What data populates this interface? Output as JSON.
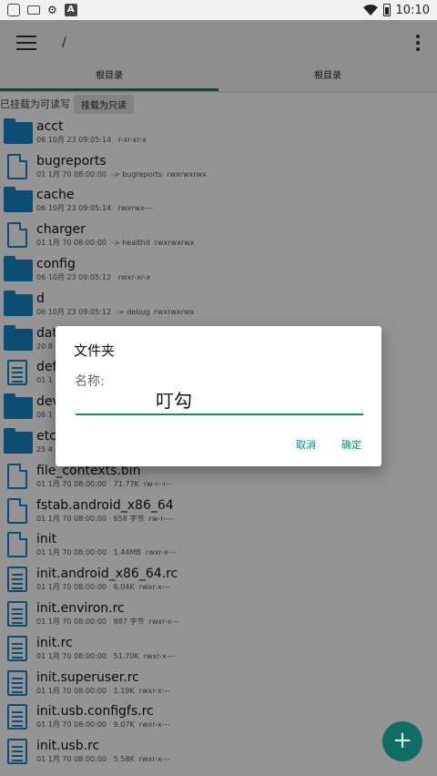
{
  "status_bar": {
    "time": "10:10",
    "icons": [
      "square-icon",
      "keyboard-icon",
      "app-icon",
      "a-icon",
      "wifi-icon",
      "battery-icon"
    ]
  },
  "app_bar": {
    "path": "/"
  },
  "tabs": [
    {
      "label": "根目录",
      "active": true
    },
    {
      "label": "根目录",
      "active": false
    }
  ],
  "mount": {
    "status": "已挂载为可读写",
    "button": "挂载为只读"
  },
  "files": [
    {
      "name": "acct",
      "meta": "06 10月 23 09:05:14   r-xr-xr-x",
      "kind": "folder"
    },
    {
      "name": "bugreports",
      "meta": "01 1月 70 08:00:00  -> bugreports  rwxrwxrwx",
      "kind": "file"
    },
    {
      "name": "cache",
      "meta": "06 10月 23 09:05:14   rwxrwx---",
      "kind": "folder"
    },
    {
      "name": "charger",
      "meta": "01 1月 70 08:00:00  -> healthd  rwxrwxrwx",
      "kind": "file"
    },
    {
      "name": "config",
      "meta": "06 10月 23 09:05:12   rwxr-xr-x",
      "kind": "folder"
    },
    {
      "name": "d",
      "meta": "06 10月 23 09:05:12  -> debug  rwxrwxrwx",
      "kind": "folder"
    },
    {
      "name": "dat",
      "meta": "20 8",
      "kind": "folder"
    },
    {
      "name": "def",
      "meta": "01 1",
      "kind": "doc"
    },
    {
      "name": "dev",
      "meta": "06 1",
      "kind": "folder"
    },
    {
      "name": "etc",
      "meta": "25 4",
      "kind": "folder"
    },
    {
      "name": "file_contexts.bin",
      "meta": "01 1月 70 08:00:00   71.77K  rw-r--r--",
      "kind": "file"
    },
    {
      "name": "fstab.android_x86_64",
      "meta": "01 1月 70 08:00:00   658 字节  rw-r----",
      "kind": "file"
    },
    {
      "name": "init",
      "meta": "01 1月 70 08:00:00   1.44MB  rwxr-x---",
      "kind": "file"
    },
    {
      "name": "init.android_x86_64.rc",
      "meta": "01 1月 70 08:00:00   6.04K  rwxr-x---",
      "kind": "doc"
    },
    {
      "name": "init.environ.rc",
      "meta": "01 1月 70 08:00:00   887 字节  rwxr-x---",
      "kind": "doc"
    },
    {
      "name": "init.rc",
      "meta": "01 1月 70 08:00:00   51.70K  rwxr-x---",
      "kind": "doc"
    },
    {
      "name": "init.superuser.rc",
      "meta": "01 1月 70 08:00:00   1.19K  rwxr-x---",
      "kind": "doc"
    },
    {
      "name": "init.usb.configfs.rc",
      "meta": "01 1月 70 08:00:00   9.07K  rwxr-x---",
      "kind": "doc"
    },
    {
      "name": "init.usb.rc",
      "meta": "01 1月 70 08:00:00   5.58K  rwxr-x---",
      "kind": "doc"
    }
  ],
  "dialog": {
    "title": "文件夹",
    "label": "名称:",
    "value": "叮勾",
    "cancel": "取消",
    "confirm": "确定"
  },
  "fab": {
    "label": "+"
  },
  "colors": {
    "accent": "#0f8a7e",
    "folder": "#1685c9",
    "fab": "#0f6d63"
  }
}
